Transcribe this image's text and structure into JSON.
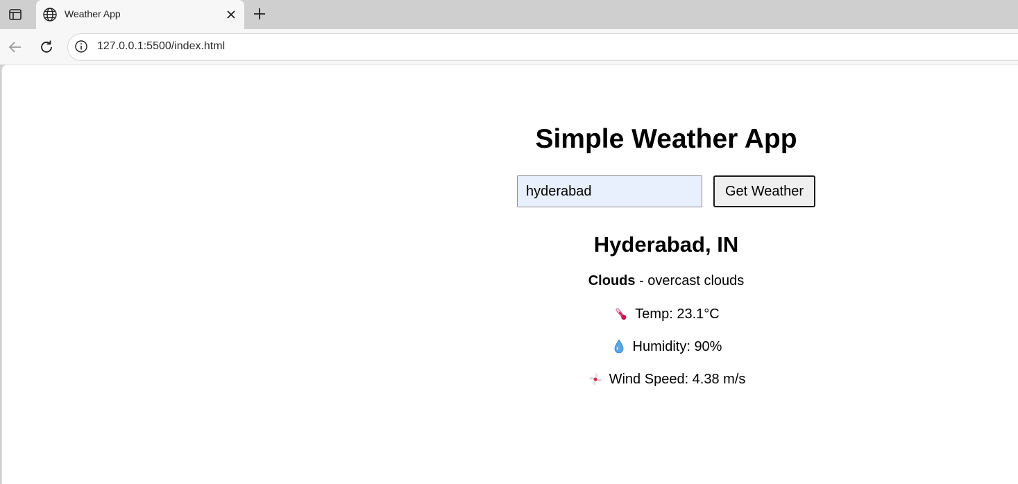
{
  "browser": {
    "tab_title": "Weather App",
    "url": "127.0.0.1:5500/index.html"
  },
  "app": {
    "title": "Simple Weather App",
    "city_input_value": "hyderabad",
    "button_label": "Get Weather",
    "location": "Hyderabad, IN",
    "condition_main": "Clouds",
    "condition_separator": " - ",
    "condition_desc": "overcast clouds",
    "temp_text": "Temp: 23.1°C",
    "humidity_text": "Humidity: 90%",
    "wind_text": "Wind Speed: 4.38 m/s"
  },
  "icons": {
    "temp": "thermometer-icon",
    "humidity": "droplet-icon",
    "wind": "wind-icon"
  }
}
